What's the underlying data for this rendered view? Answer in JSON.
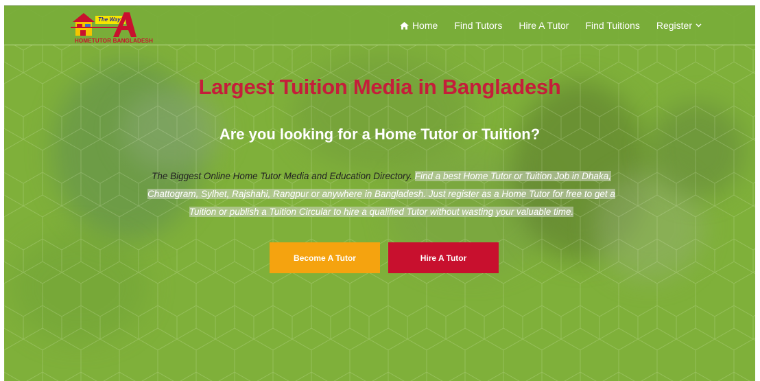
{
  "brand": {
    "logo_text": "HOMETUTOR BANGLADESH",
    "logo_tagline": "The Way"
  },
  "nav": {
    "items": [
      {
        "label": "Home",
        "icon": "home-icon"
      },
      {
        "label": "Find Tutors"
      },
      {
        "label": "Hire A Tutor"
      },
      {
        "label": "Find Tuitions"
      },
      {
        "label": "Register",
        "icon": "chevron-down-icon"
      }
    ]
  },
  "hero": {
    "title": "Largest Tuition Media in Bangladesh",
    "subtitle": "Are you looking for a Home Tutor or Tuition?",
    "description_lead": "The Biggest Online Home Tutor Media and Education Directory.",
    "description_rest": "Find a best Home Tutor or Tuition Job in Dhaka, Chattogram, Sylhet, Rajshahi, Rangpur or anywhere in Bangladesh. Just register as a Home Tutor for free to get a Tuition or publish a Tuition Circular to hire a qualified Tutor without wasting your valuable time."
  },
  "buttons": {
    "become_tutor": "Become A Tutor",
    "hire_tutor": "Hire A Tutor"
  },
  "colors": {
    "background_green": "#7fb03a",
    "title_red": "#c41e3a",
    "become_orange": "#f5a30f",
    "hire_red": "#c8102e"
  }
}
